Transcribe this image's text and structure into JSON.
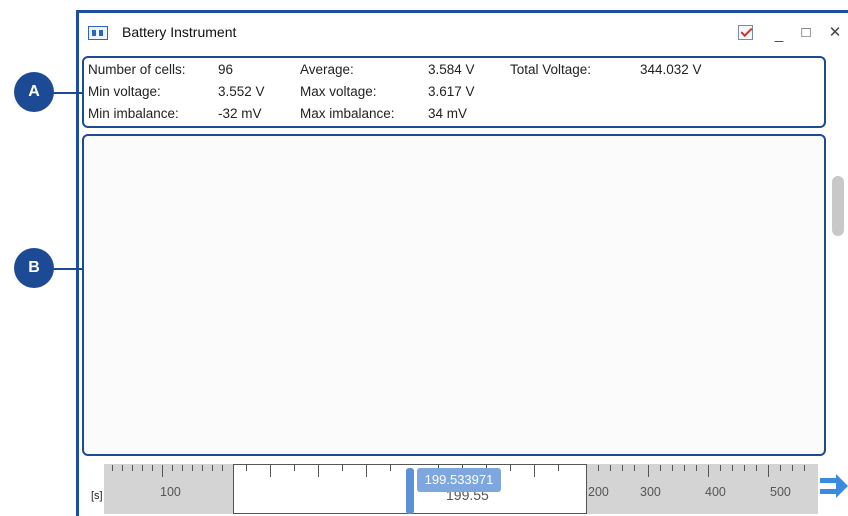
{
  "window": {
    "title": "Battery Instrument",
    "minimize_glyph": "_",
    "maximize_glyph": "□",
    "close_glyph": "✕",
    "accent_color": "#1c4a94"
  },
  "callouts": {
    "a": "A",
    "b": "B"
  },
  "stats": {
    "number_of_cells": {
      "label": "Number of cells:",
      "value": "96"
    },
    "average": {
      "label": "Average:",
      "value": "3.584 V"
    },
    "total_voltage": {
      "label": "Total Voltage:",
      "value": "344.032 V"
    },
    "min_voltage": {
      "label": "Min voltage:",
      "value": "3.552 V"
    },
    "max_voltage": {
      "label": "Max voltage:",
      "value": "3.617 V"
    },
    "min_imbalance": {
      "label": "Min imbalance:",
      "value": "-32 mV"
    },
    "max_imbalance": {
      "label": "Max imbalance:",
      "value": "34 mV"
    }
  },
  "timeline": {
    "unit": "[s]",
    "labels": [
      "100",
      "199.55",
      "200",
      "300",
      "400",
      "500"
    ],
    "cursor_value": "199.533971"
  },
  "icons": {
    "app": "battery-instrument-icon",
    "pin": "pin-icon",
    "scroll": "scroll-right-arrow-icon"
  }
}
